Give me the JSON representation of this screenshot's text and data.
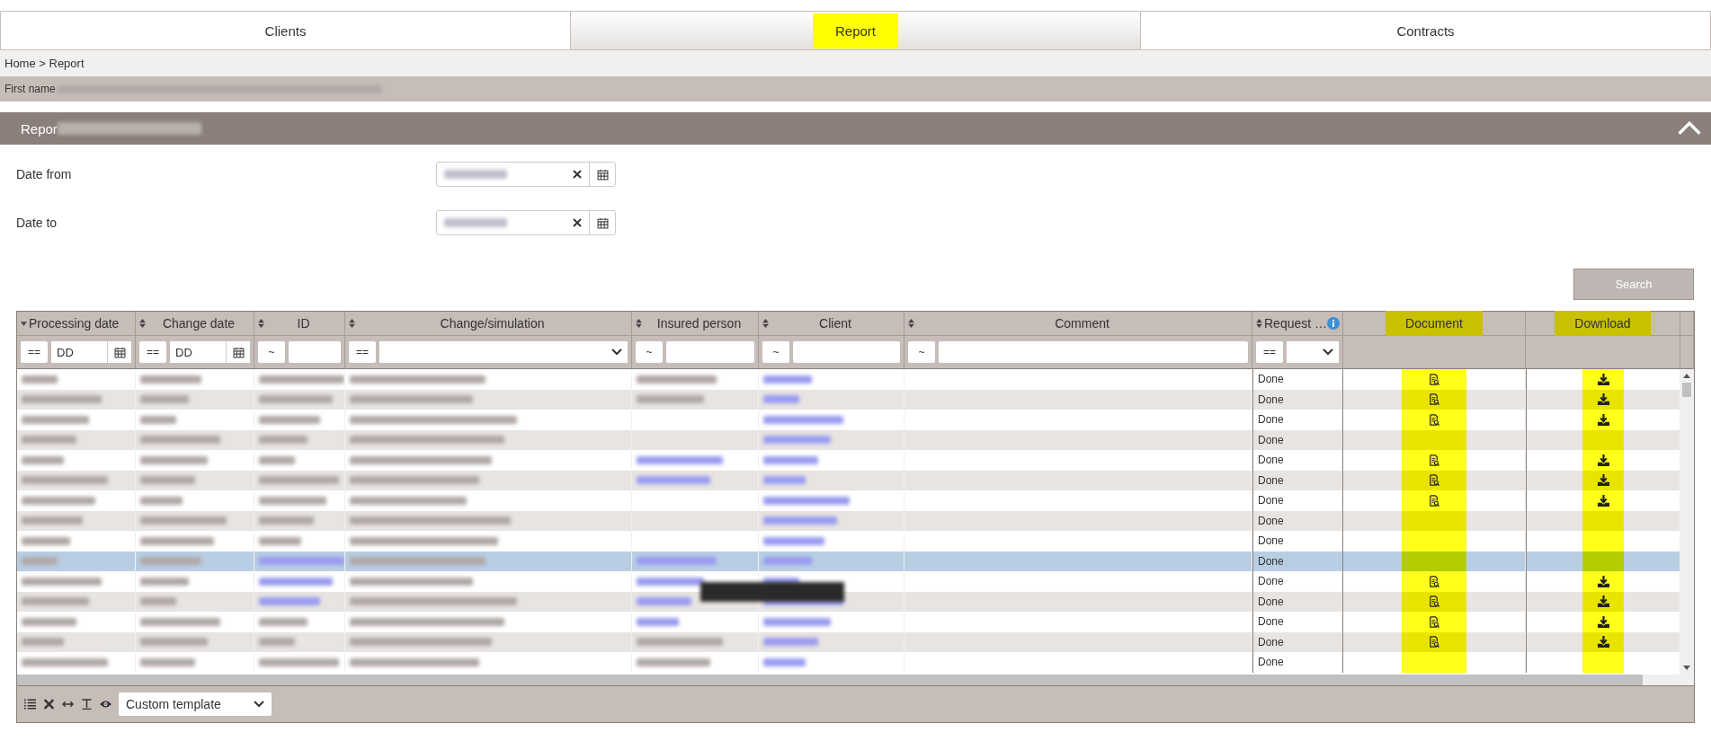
{
  "tabs": [
    {
      "label": "Clients",
      "selected": false,
      "highlighted": false
    },
    {
      "label": "Report",
      "selected": true,
      "highlighted": true
    },
    {
      "label": "Contracts",
      "selected": false,
      "highlighted": false
    }
  ],
  "breadcrumb": "Home > Report",
  "client_bar": {
    "label": "First name"
  },
  "panel": {
    "title": "Repor",
    "expanded": true
  },
  "filters": [
    {
      "label": "Date from"
    },
    {
      "label": "Date to"
    }
  ],
  "search_button": "Search",
  "table": {
    "columns": [
      {
        "label": "Processing date",
        "sorted": true,
        "highlighted": false,
        "filter": {
          "kind": "date",
          "operator": "==",
          "placeholder": "DD"
        }
      },
      {
        "label": "Change date",
        "sorted": false,
        "highlighted": false,
        "filter": {
          "kind": "date",
          "operator": "==",
          "placeholder": "DD"
        }
      },
      {
        "label": "ID",
        "sorted": false,
        "highlighted": false,
        "filter": {
          "kind": "text",
          "operator": "~"
        }
      },
      {
        "label": "Change/simulation",
        "sorted": false,
        "highlighted": false,
        "filter": {
          "kind": "select",
          "operator": "=="
        }
      },
      {
        "label": "Insured person",
        "sorted": false,
        "highlighted": false,
        "filter": {
          "kind": "text",
          "operator": "~"
        }
      },
      {
        "label": "Client",
        "sorted": false,
        "highlighted": false,
        "filter": {
          "kind": "text",
          "operator": "~"
        }
      },
      {
        "label": "Comment",
        "sorted": false,
        "highlighted": false,
        "filter": {
          "kind": "text",
          "operator": "~"
        }
      },
      {
        "label": "Request …",
        "sorted": false,
        "highlighted": false,
        "info": true,
        "filter": {
          "kind": "select",
          "operator": "=="
        }
      },
      {
        "label": "Document",
        "highlighted": true
      },
      {
        "label": "Download",
        "highlighted": true
      }
    ],
    "rows": [
      {
        "cells": [
          {
            "kind": "redacted"
          },
          {
            "kind": "redacted"
          },
          {
            "kind": "redacted"
          },
          {
            "kind": "redacted"
          },
          {
            "kind": "redacted"
          },
          {
            "kind": "redacted_link"
          },
          {
            "kind": "empty"
          }
        ],
        "request": "Done",
        "document": true,
        "download": true,
        "selected": false
      },
      {
        "cells": [
          {
            "kind": "redacted"
          },
          {
            "kind": "redacted"
          },
          {
            "kind": "redacted"
          },
          {
            "kind": "redacted"
          },
          {
            "kind": "redacted"
          },
          {
            "kind": "redacted_link"
          },
          {
            "kind": "empty"
          }
        ],
        "request": "Done",
        "document": true,
        "download": true,
        "selected": false
      },
      {
        "cells": [
          {
            "kind": "redacted"
          },
          {
            "kind": "redacted"
          },
          {
            "kind": "redacted"
          },
          {
            "kind": "redacted"
          },
          {
            "kind": "empty"
          },
          {
            "kind": "redacted_link"
          },
          {
            "kind": "empty"
          }
        ],
        "request": "Done",
        "document": true,
        "download": true,
        "selected": false
      },
      {
        "cells": [
          {
            "kind": "redacted"
          },
          {
            "kind": "redacted"
          },
          {
            "kind": "redacted"
          },
          {
            "kind": "redacted"
          },
          {
            "kind": "empty"
          },
          {
            "kind": "redacted_link"
          },
          {
            "kind": "empty"
          }
        ],
        "request": "Done",
        "document": false,
        "download": false,
        "selected": false
      },
      {
        "cells": [
          {
            "kind": "redacted"
          },
          {
            "kind": "redacted"
          },
          {
            "kind": "redacted"
          },
          {
            "kind": "redacted"
          },
          {
            "kind": "redacted_link"
          },
          {
            "kind": "redacted_link"
          },
          {
            "kind": "empty"
          }
        ],
        "request": "Done",
        "document": true,
        "download": true,
        "selected": false
      },
      {
        "cells": [
          {
            "kind": "redacted"
          },
          {
            "kind": "redacted"
          },
          {
            "kind": "redacted"
          },
          {
            "kind": "redacted"
          },
          {
            "kind": "redacted_link"
          },
          {
            "kind": "redacted_link"
          },
          {
            "kind": "empty"
          }
        ],
        "request": "Done",
        "document": true,
        "download": true,
        "selected": false
      },
      {
        "cells": [
          {
            "kind": "redacted"
          },
          {
            "kind": "redacted"
          },
          {
            "kind": "redacted"
          },
          {
            "kind": "redacted"
          },
          {
            "kind": "empty"
          },
          {
            "kind": "redacted_link"
          },
          {
            "kind": "empty"
          }
        ],
        "request": "Done",
        "document": true,
        "download": true,
        "selected": false
      },
      {
        "cells": [
          {
            "kind": "redacted"
          },
          {
            "kind": "redacted"
          },
          {
            "kind": "redacted"
          },
          {
            "kind": "redacted"
          },
          {
            "kind": "empty"
          },
          {
            "kind": "redacted_link"
          },
          {
            "kind": "empty"
          }
        ],
        "request": "Done",
        "document": false,
        "download": false,
        "selected": false
      },
      {
        "cells": [
          {
            "kind": "redacted"
          },
          {
            "kind": "redacted"
          },
          {
            "kind": "redacted"
          },
          {
            "kind": "redacted"
          },
          {
            "kind": "empty"
          },
          {
            "kind": "redacted_link"
          },
          {
            "kind": "empty"
          }
        ],
        "request": "Done",
        "document": false,
        "download": false,
        "selected": false
      },
      {
        "cells": [
          {
            "kind": "redacted"
          },
          {
            "kind": "redacted"
          },
          {
            "kind": "redacted_link"
          },
          {
            "kind": "redacted"
          },
          {
            "kind": "redacted_link"
          },
          {
            "kind": "redacted_link"
          },
          {
            "kind": "empty"
          }
        ],
        "request": "Done",
        "document": false,
        "download": false,
        "selected": true
      },
      {
        "cells": [
          {
            "kind": "redacted"
          },
          {
            "kind": "redacted"
          },
          {
            "kind": "redacted_link"
          },
          {
            "kind": "redacted"
          },
          {
            "kind": "redacted_link"
          },
          {
            "kind": "redacted_link"
          },
          {
            "kind": "empty"
          }
        ],
        "request": "Done",
        "document": true,
        "download": true,
        "selected": false
      },
      {
        "cells": [
          {
            "kind": "redacted"
          },
          {
            "kind": "redacted"
          },
          {
            "kind": "redacted_link"
          },
          {
            "kind": "redacted"
          },
          {
            "kind": "redacted_link"
          },
          {
            "kind": "redacted_link"
          },
          {
            "kind": "empty"
          }
        ],
        "request": "Done",
        "document": true,
        "download": true,
        "selected": false
      },
      {
        "cells": [
          {
            "kind": "redacted"
          },
          {
            "kind": "redacted"
          },
          {
            "kind": "redacted"
          },
          {
            "kind": "redacted"
          },
          {
            "kind": "redacted_link"
          },
          {
            "kind": "redacted_link"
          },
          {
            "kind": "empty"
          }
        ],
        "request": "Done",
        "document": true,
        "download": true,
        "selected": false
      },
      {
        "cells": [
          {
            "kind": "redacted"
          },
          {
            "kind": "redacted"
          },
          {
            "kind": "redacted"
          },
          {
            "kind": "redacted"
          },
          {
            "kind": "redacted"
          },
          {
            "kind": "redacted_link"
          },
          {
            "kind": "empty"
          }
        ],
        "request": "Done",
        "document": true,
        "download": true,
        "selected": false
      },
      {
        "cells": [
          {
            "kind": "redacted"
          },
          {
            "kind": "redacted"
          },
          {
            "kind": "redacted"
          },
          {
            "kind": "redacted"
          },
          {
            "kind": "redacted"
          },
          {
            "kind": "redacted_link"
          },
          {
            "kind": "empty"
          }
        ],
        "request": "Done",
        "document": false,
        "download": false,
        "selected": false
      }
    ]
  },
  "footer": {
    "template": "Custom template"
  }
}
